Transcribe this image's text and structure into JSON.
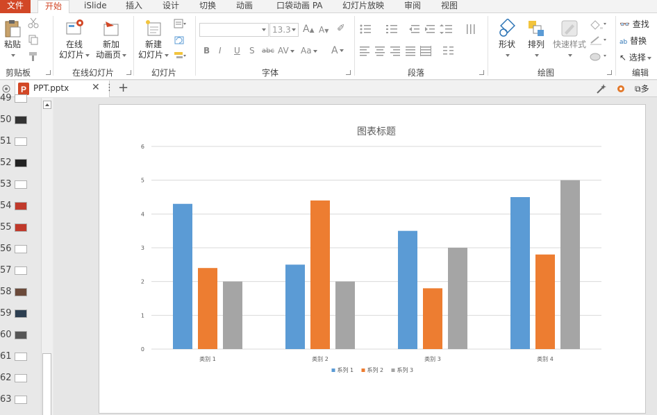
{
  "menu": {
    "file": "文件",
    "tabs": [
      "开始",
      "iSlide",
      "插入",
      "设计",
      "切换",
      "动画",
      "口袋动画 PA",
      "幻灯片放映",
      "审阅",
      "视图"
    ]
  },
  "ribbon": {
    "clipboard": {
      "paste": "粘贴",
      "label": "剪贴板"
    },
    "online": {
      "online_slides_1": "在线",
      "online_slides_2": "幻灯片",
      "new_anim_1": "新加",
      "new_anim_2": "动画页",
      "label": "在线幻灯片"
    },
    "slides": {
      "new_slide_1": "新建",
      "new_slide_2": "幻灯片",
      "label": "幻灯片"
    },
    "font": {
      "font_name": "",
      "font_size": "13.3",
      "label": "字体",
      "bold": "B",
      "italic": "I",
      "underline": "U",
      "shadow": "S",
      "strike": "abc",
      "spacing": "AV",
      "case": "Aa",
      "color": "A"
    },
    "paragraph": {
      "label": "段落"
    },
    "drawing": {
      "shapes": "形状",
      "arrange": "排列",
      "quick_styles": "快速样式",
      "label": "绘图"
    },
    "editing": {
      "find": "查找",
      "replace": "替换",
      "select": "选择",
      "label": "编辑"
    }
  },
  "doc_tab": {
    "filename": "PPT.pptx",
    "more": "多"
  },
  "thumbnails": [
    "49",
    "50",
    "51",
    "52",
    "53",
    "54",
    "55",
    "56",
    "57",
    "58",
    "59",
    "60",
    "61",
    "62",
    "63"
  ],
  "colors": {
    "accent": "#d24726",
    "series1": "#5b9bd5",
    "series2": "#ed7d31",
    "series3": "#a5a5a5"
  },
  "chart_data": {
    "type": "bar",
    "title": "图表标题",
    "categories": [
      "类别 1",
      "类别 2",
      "类别 3",
      "类别 4"
    ],
    "series": [
      {
        "name": "系列 1",
        "values": [
          4.3,
          2.5,
          3.5,
          4.5
        ]
      },
      {
        "name": "系列 2",
        "values": [
          2.4,
          4.4,
          1.8,
          2.8
        ]
      },
      {
        "name": "系列 3",
        "values": [
          2,
          2,
          3,
          5
        ]
      }
    ],
    "ylim": [
      0,
      6
    ],
    "yticks": [
      "0",
      "1",
      "2",
      "3",
      "4",
      "5",
      "6"
    ],
    "grid": true,
    "legend": "bottom"
  }
}
